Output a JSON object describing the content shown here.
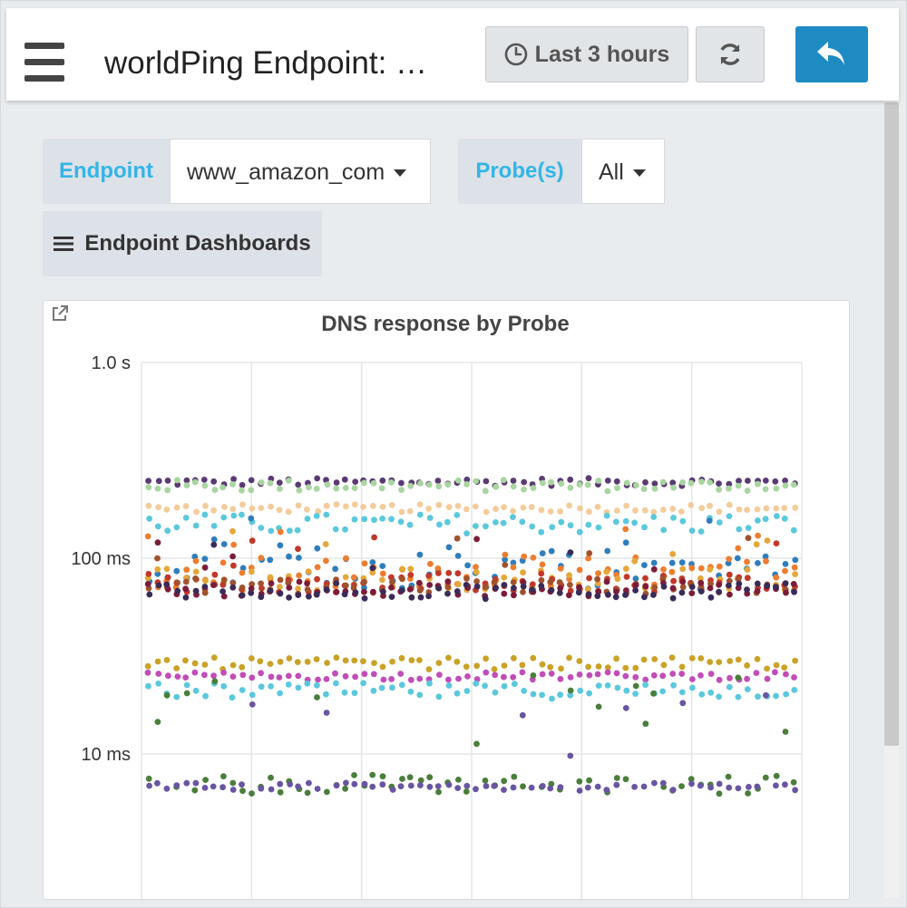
{
  "header": {
    "title": "worldPing Endpoint: …",
    "time_range_label": "Last 3 hours",
    "icons": {
      "menu": "hamburger-menu-icon",
      "clock": "clock-icon",
      "refresh": "refresh-icon",
      "back": "back-arrow-icon"
    },
    "colors": {
      "back_button": "#1e8bc3"
    }
  },
  "variables": {
    "endpoint_label": "Endpoint",
    "endpoint_value": "www_amazon_com",
    "probes_label": "Probe(s)",
    "probes_value": "All",
    "label_color": "#33b5e5"
  },
  "dashboards_button": "Endpoint Dashboards",
  "panel": {
    "title": "DNS response by Probe",
    "link_icon": "external-link-icon"
  },
  "chart_data": {
    "type": "scatter",
    "title": "DNS response by Probe",
    "y_scale": "log",
    "y_unit": "s",
    "ylim": [
      0.002,
      1.0
    ],
    "y_ticks": [
      {
        "value": 1.0,
        "label": "1.0 s"
      },
      {
        "value": 0.1,
        "label": "100 ms"
      },
      {
        "value": 0.01,
        "label": "10 ms"
      }
    ],
    "grid": true,
    "points_per_series": 70,
    "series": [
      {
        "color": "#5b3a74",
        "level": 0.245,
        "jitter": 0.02
      },
      {
        "color": "#a8d5a0",
        "level": 0.235,
        "jitter": 0.03
      },
      {
        "color": "#f3cc9b",
        "level": 0.18,
        "jitter": 0.02
      },
      {
        "color": "#5bc8dc",
        "level": 0.15,
        "jitter": 0.05
      },
      {
        "color": "#2f7ebc",
        "level": 0.09,
        "jitter": 0.12
      },
      {
        "color": "#ed7d31",
        "level": 0.085,
        "jitter": 0.08
      },
      {
        "color": "#e4a83a",
        "level": 0.078,
        "jitter": 0.06
      },
      {
        "color": "#c0392b",
        "level": 0.075,
        "jitter": 0.05
      },
      {
        "color": "#a0522d",
        "level": 0.072,
        "jitter": 0.04
      },
      {
        "color": "#7b1d3a",
        "level": 0.07,
        "jitter": 0.04
      },
      {
        "color": "#3a2b57",
        "level": 0.068,
        "jitter": 0.04
      },
      {
        "color": "#c9a227",
        "level": 0.029,
        "jitter": 0.03
      },
      {
        "color": "#c14db8",
        "level": 0.025,
        "jitter": 0.02
      },
      {
        "color": "#5bc8dc",
        "level": 0.021,
        "jitter": 0.04
      },
      {
        "color": "#4a7e3b",
        "level": 0.007,
        "jitter": 0.05
      },
      {
        "color": "#6a55a1",
        "level": 0.0068,
        "jitter": 0.02
      }
    ]
  }
}
